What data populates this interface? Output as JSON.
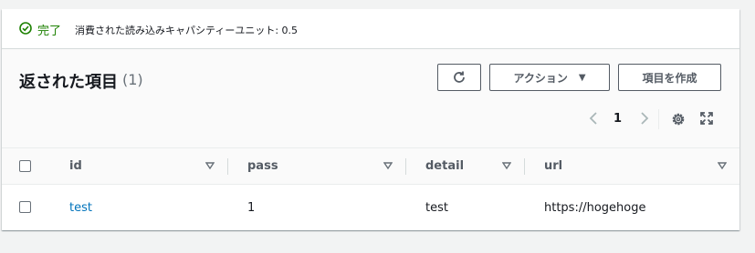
{
  "status": {
    "label": "完了",
    "message": "消費された読み込みキャパシティーユニット: 0.5",
    "color": "#1d8102"
  },
  "header": {
    "title": "返された項目",
    "count": "(1)"
  },
  "toolbar": {
    "actions_label": "アクション",
    "create_label": "項目を作成"
  },
  "pagination": {
    "current_page": "1"
  },
  "table": {
    "columns": [
      "id",
      "pass",
      "detail",
      "url"
    ],
    "rows": [
      {
        "id": "test",
        "pass": "1",
        "detail": "test",
        "url": "https://hogehoge"
      }
    ]
  },
  "colors": {
    "link": "#0073bb",
    "success": "#1d8102",
    "border": "#545b64"
  }
}
